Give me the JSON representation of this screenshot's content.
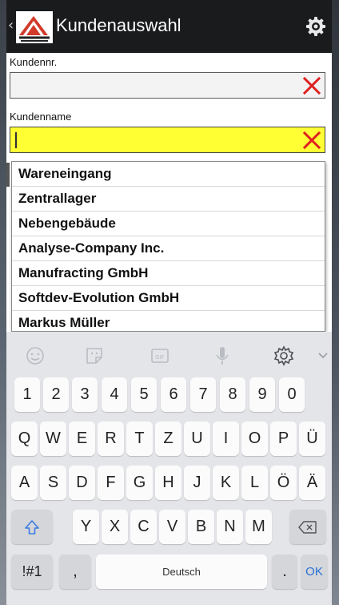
{
  "app": {
    "title": "Kundenauswahl",
    "back_glyph": "‹",
    "logo_icon": "company-logo",
    "settings_icon": "gear-icon"
  },
  "form": {
    "customer_number": {
      "label": "Kundennr.",
      "value": "",
      "clear_icon": "close-icon"
    },
    "customer_name": {
      "label": "Kundenname",
      "value": "",
      "clear_icon": "close-icon",
      "focused": true
    }
  },
  "suggestions": [
    "Wareneingang",
    "Zentrallager",
    "Nebengebäude",
    "Analyse-Company Inc.",
    "Manufracting GmbH",
    "Softdev-Evolution GmbH",
    "Markus Müller"
  ],
  "keyboard": {
    "toolbar": [
      "emoji-icon",
      "sticker-icon",
      "gif-icon",
      "mic-icon",
      "settings-icon",
      "chevron-down-icon"
    ],
    "row_numbers": [
      "1",
      "2",
      "3",
      "4",
      "5",
      "6",
      "7",
      "8",
      "9",
      "0"
    ],
    "row_1": [
      "Q",
      "W",
      "E",
      "R",
      "T",
      "Z",
      "U",
      "I",
      "O",
      "P",
      "Ü"
    ],
    "row_2": [
      "A",
      "S",
      "D",
      "F",
      "G",
      "H",
      "J",
      "K",
      "L",
      "Ö",
      "Ä"
    ],
    "row_3": [
      "Y",
      "X",
      "C",
      "V",
      "B",
      "N",
      "M"
    ],
    "symbols_key": "!#1",
    "comma_key": ",",
    "space_label": "Deutsch",
    "period_key": ".",
    "ok_key": "OK",
    "shift_icon": "shift-icon",
    "backspace_icon": "backspace-icon"
  },
  "colors": {
    "appbar": "#191b1d",
    "active_field": "#ffff33",
    "clear_x": "#e02020",
    "ok_key": "#2b6fd6"
  }
}
